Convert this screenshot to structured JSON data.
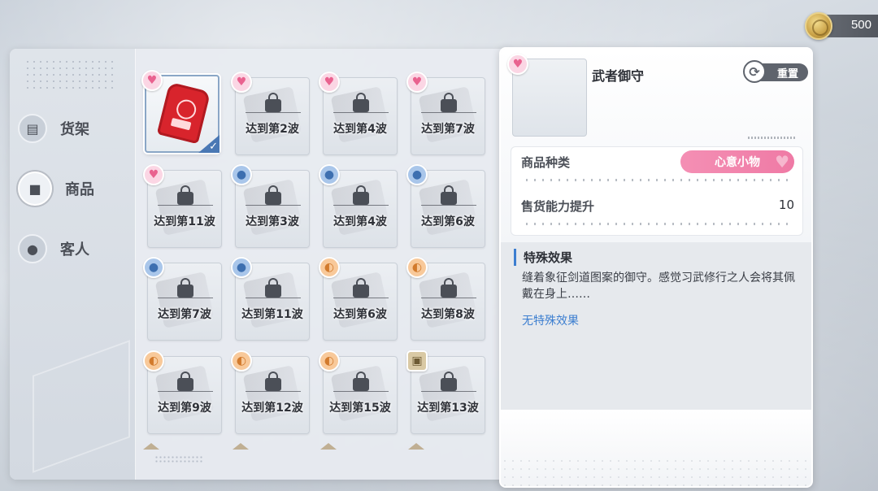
{
  "currency": {
    "amount": "500",
    "icon": "coin-icon"
  },
  "sidebar": {
    "items": [
      {
        "label": "货架",
        "icon": "shelf-icon",
        "active": false
      },
      {
        "label": "商品",
        "icon": "product-bag-icon",
        "active": true
      },
      {
        "label": "客人",
        "icon": "person-icon",
        "active": false
      }
    ]
  },
  "grid": {
    "cells": [
      {
        "req": "",
        "badge": "heart",
        "selected": true
      },
      {
        "req": "达到第2波",
        "badge": "heart"
      },
      {
        "req": "达到第4波",
        "badge": "heart"
      },
      {
        "req": "达到第7波",
        "badge": "heart"
      },
      {
        "req": "达到第11波",
        "badge": "heart"
      },
      {
        "req": "达到第3波",
        "badge": "bag"
      },
      {
        "req": "达到第4波",
        "badge": "bag"
      },
      {
        "req": "达到第6波",
        "badge": "bag"
      },
      {
        "req": "达到第7波",
        "badge": "bag"
      },
      {
        "req": "达到第11波",
        "badge": "bag"
      },
      {
        "req": "达到第6波",
        "badge": "ear"
      },
      {
        "req": "达到第8波",
        "badge": "ear"
      },
      {
        "req": "达到第9波",
        "badge": "ear"
      },
      {
        "req": "达到第12波",
        "badge": "ear"
      },
      {
        "req": "达到第15波",
        "badge": "ear"
      },
      {
        "req": "达到第13波",
        "badge": "box"
      }
    ]
  },
  "detail": {
    "name": "武者御守",
    "reset_label": "重置",
    "category_label": "商品种类",
    "category_value": "心意小物",
    "ability_label": "售货能力提升",
    "ability_value": "10",
    "effect_title": "特殊效果",
    "effect_desc": "缝着象征剑道图案的御守。感觉习武修行之人会将其佩戴在身上……",
    "effect_link": "无特殊效果"
  },
  "colors": {
    "accent_pink": "#ef7aa5",
    "accent_blue": "#3c7ed0"
  }
}
